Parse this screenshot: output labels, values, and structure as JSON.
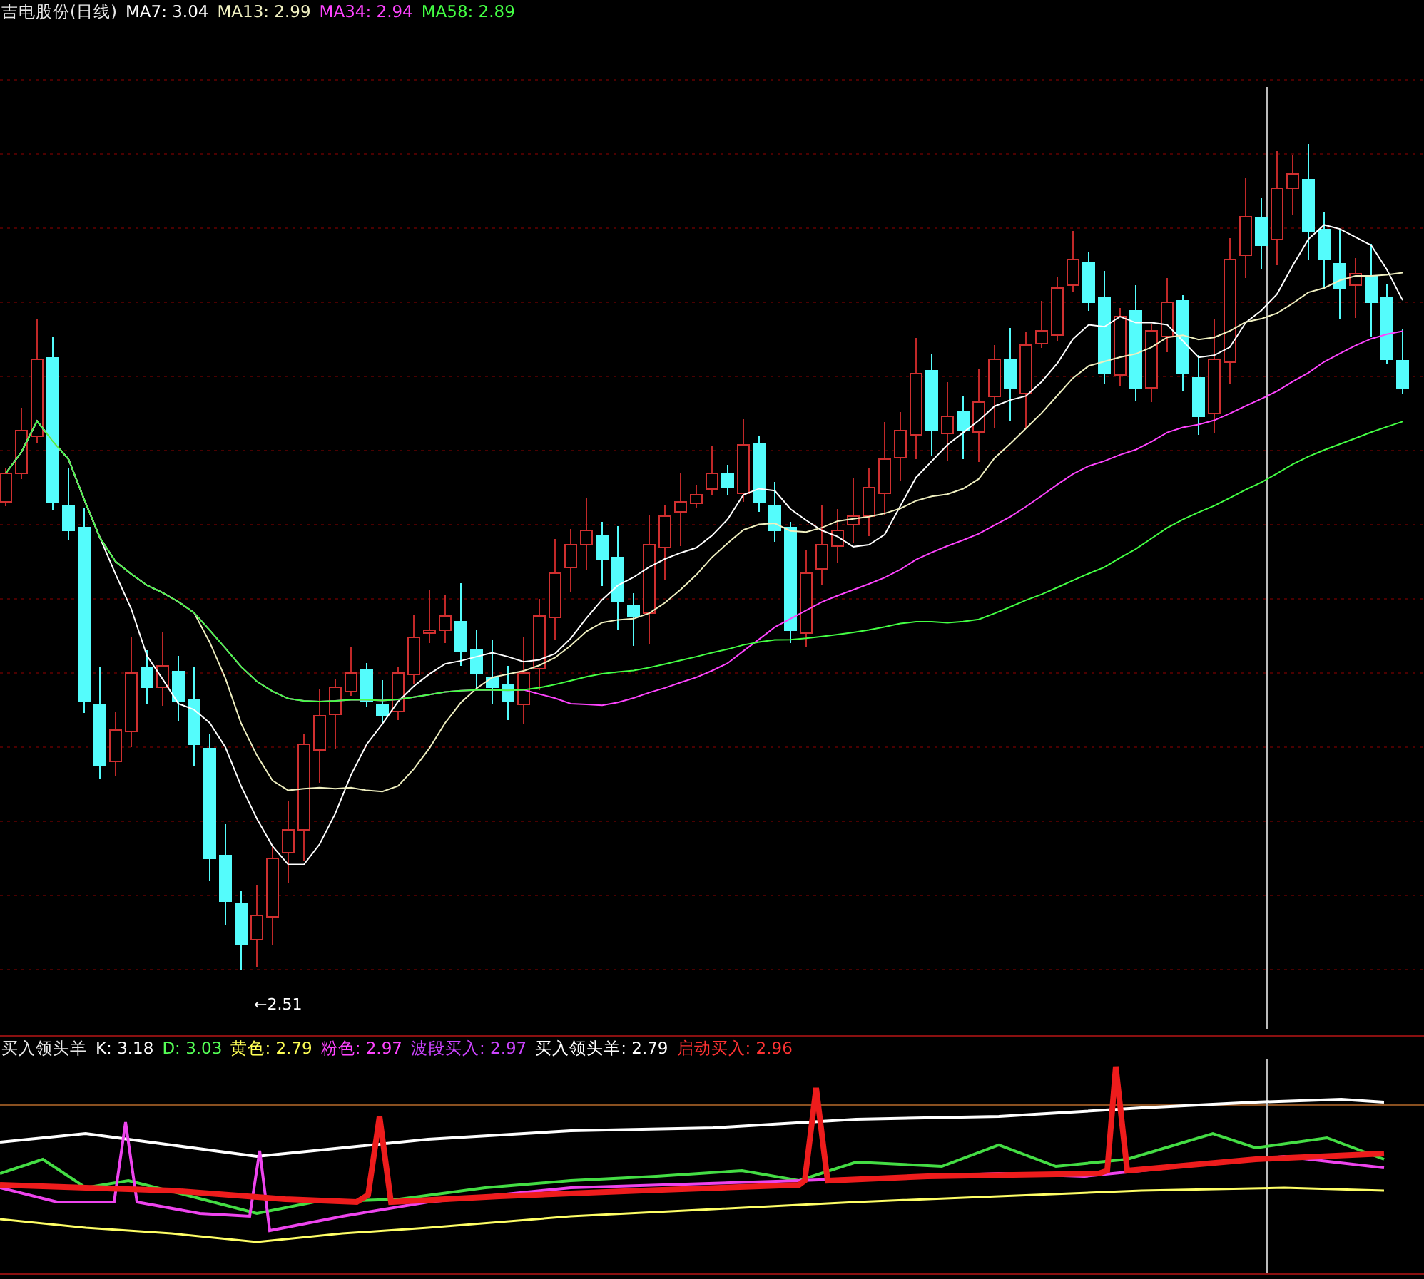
{
  "chart_header": {
    "name": "吉电股份(日线)",
    "items": [
      {
        "label": "MA7:",
        "value": "3.04",
        "color": "#ffffff"
      },
      {
        "label": "MA13:",
        "value": "2.99",
        "color": "#f0f0c0"
      },
      {
        "label": "MA34:",
        "value": "2.94",
        "color": "#ff44ff"
      },
      {
        "label": "MA58:",
        "value": "2.89",
        "color": "#44ff44"
      }
    ]
  },
  "low_price_label": "←2.51",
  "indicator_header": {
    "name": "买入领头羊",
    "items": [
      {
        "label": "K:",
        "value": "3.18",
        "color": "#ffffff"
      },
      {
        "label": "D:",
        "value": "3.03",
        "color": "#55ff55"
      },
      {
        "label": "黄色:",
        "value": "2.79",
        "color": "#ffff55"
      },
      {
        "label": "粉色:",
        "value": "2.97",
        "color": "#ff44ff"
      },
      {
        "label": "波段买入:",
        "value": "2.97",
        "color": "#cc44ff"
      },
      {
        "label": "买入领头羊:",
        "value": "2.79",
        "color": "#fefefe"
      },
      {
        "label": "启动买入:",
        "value": "2.96",
        "color": "#ff3333"
      }
    ]
  }
}
